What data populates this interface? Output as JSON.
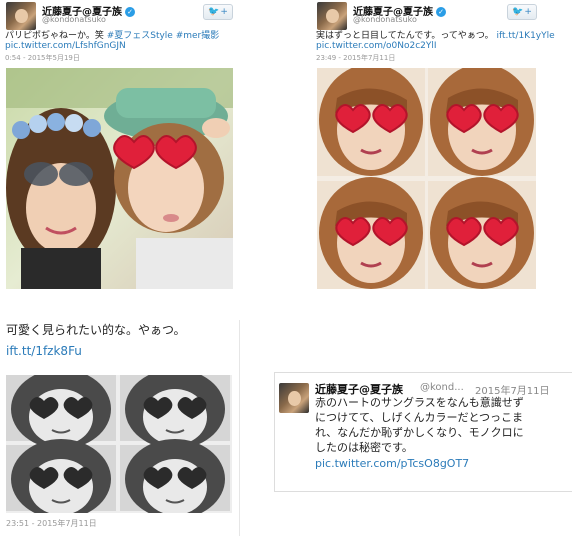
{
  "tweet1": {
    "name": "近藤夏子@夏子族",
    "handle": "@kondonatsuko",
    "text_line1": "パリピポぢゃねーか。笑 ",
    "hashtags": "#夏フェスStyle #mer撮影",
    "link": "pic.twitter.com/LfshfGnGJN",
    "timestamp": "0:54 - 2015年5月19日",
    "follow_label": "+"
  },
  "tweet2": {
    "name": "近藤夏子@夏子族",
    "handle": "@kondonatsuko",
    "text_line1": "実はずっと日目してたんです。ってやぁつ。",
    "link_inline": "ift.tt/1K1yYle",
    "link": "pic.twitter.com/o0No2c2YlI",
    "timestamp": "23:49 - 2015年7月11日",
    "follow_label": "+"
  },
  "tweet3": {
    "text_line1": "可愛く見られたい的な。やぁつ。",
    "link": "ift.tt/1fzk8Fu",
    "timestamp": "23:51 - 2015年7月11日"
  },
  "tweet4": {
    "name": "近藤夏子@夏子族",
    "handle": "@kond...",
    "date": "2015年7月11日",
    "lines": [
      "赤のハートのサングラスをなんも意識せず",
      "につけてて、しげくんカラーだとつっこま",
      "れ、なんだか恥ずかしくなり、モノクロに",
      "したのは秘密です。"
    ],
    "link": "pic.twitter.com/pTcsO8gOT7"
  },
  "colors": {
    "link": "#2b7bb9",
    "verified": "#2a9de6",
    "heart_glasses": "#e0203a"
  }
}
